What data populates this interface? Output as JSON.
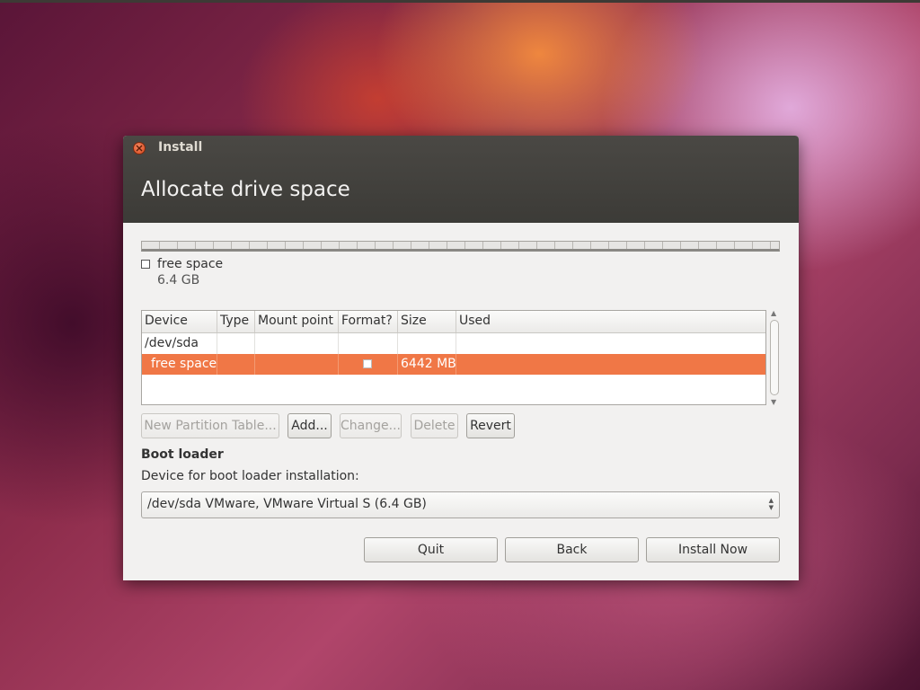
{
  "window": {
    "title": "Install",
    "page_title": "Allocate drive space"
  },
  "partition_bar": {
    "legend_label": "free space",
    "legend_size": "6.4 GB"
  },
  "table": {
    "columns": [
      "Device",
      "Type",
      "Mount point",
      "Format?",
      "Size",
      "Used"
    ],
    "rows": [
      {
        "device": "/dev/sda",
        "type": "",
        "mount": "",
        "format": "",
        "size": "",
        "used": ""
      },
      {
        "device": "free space",
        "type": "",
        "mount": "",
        "format": "",
        "size": "6442 MB",
        "used": ""
      }
    ]
  },
  "actions": {
    "new_partition_table": "New Partition Table...",
    "add": "Add...",
    "change": "Change...",
    "delete": "Delete",
    "revert": "Revert"
  },
  "boot_loader": {
    "heading": "Boot loader",
    "label": "Device for boot loader installation:",
    "selected": "/dev/sda VMware, VMware Virtual S (6.4 GB)"
  },
  "footer": {
    "quit": "Quit",
    "back": "Back",
    "install_now": "Install Now"
  },
  "colors": {
    "selection": "#f07746",
    "titlebar": "#3c3b37"
  }
}
